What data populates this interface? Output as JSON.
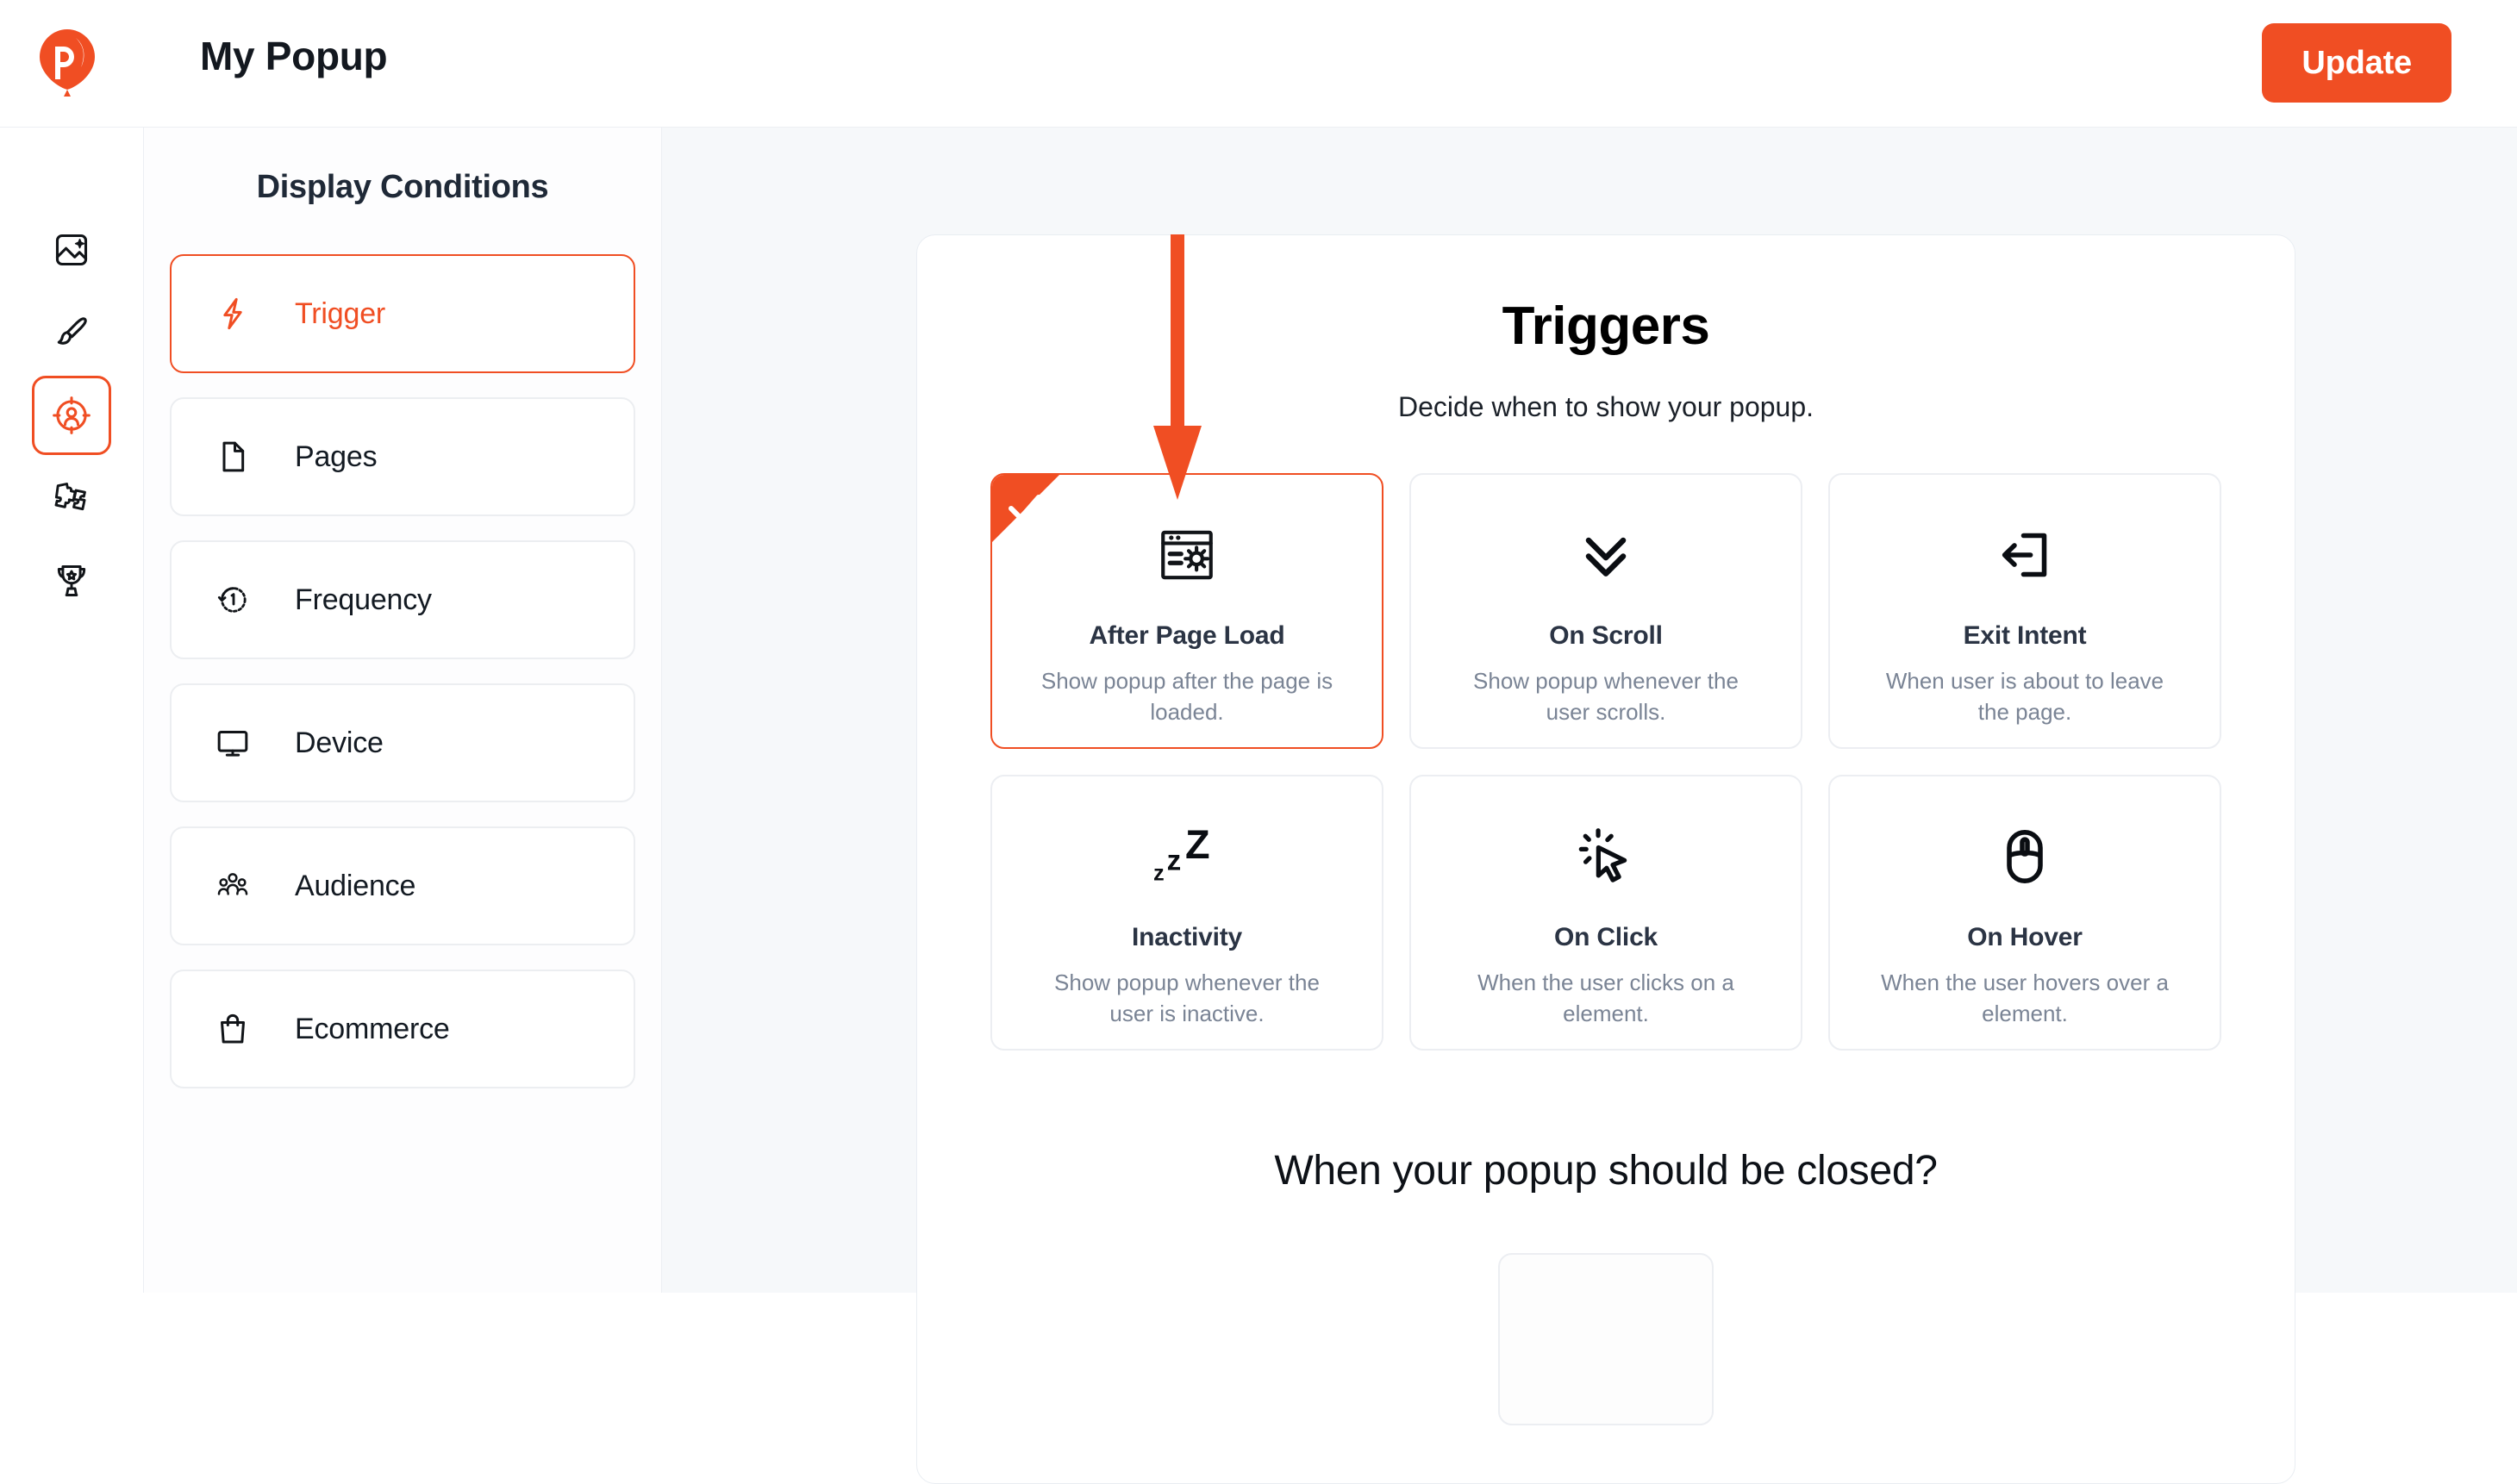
{
  "brand": {
    "accent": "#f04e23",
    "logo_icon": "balloon-p-logo",
    "text_dark": "#13181f"
  },
  "header": {
    "title": "My Popup",
    "update_label": "Update"
  },
  "rail": {
    "items": [
      {
        "icon": "image-icon",
        "name": "media",
        "active": false
      },
      {
        "icon": "paintbrush-icon",
        "name": "design",
        "active": false
      },
      {
        "icon": "target-audience-icon",
        "name": "display-conditions",
        "active": true
      },
      {
        "icon": "puzzle-icon",
        "name": "integrations",
        "active": false
      },
      {
        "icon": "trophy-icon",
        "name": "goals",
        "active": false
      }
    ]
  },
  "panel": {
    "title": "Display Conditions",
    "items": [
      {
        "label": "Trigger",
        "icon": "lightning-bolt-icon",
        "active": true
      },
      {
        "label": "Pages",
        "icon": "document-icon",
        "active": false
      },
      {
        "label": "Frequency",
        "icon": "clock-history-icon",
        "active": false
      },
      {
        "label": "Device",
        "icon": "monitor-icon",
        "active": false
      },
      {
        "label": "Audience",
        "icon": "people-group-icon",
        "active": false
      },
      {
        "label": "Ecommerce",
        "icon": "shopping-bag-icon",
        "active": false
      }
    ]
  },
  "main": {
    "title": "Triggers",
    "subtitle": "Decide when to show your popup.",
    "triggers": [
      {
        "title": "After Page Load",
        "desc": "Show popup after the page is loaded.",
        "icon": "browser-window-sun-icon",
        "selected": true
      },
      {
        "title": "On Scroll",
        "desc": "Show popup whenever the user scrolls.",
        "icon": "double-chevron-down-icon",
        "selected": false
      },
      {
        "title": "Exit Intent",
        "desc": "When user is about to leave the page.",
        "icon": "exit-door-arrow-icon",
        "selected": false
      },
      {
        "title": "Inactivity",
        "desc": "Show popup whenever the user is inactive.",
        "icon": "sleep-zzz-icon",
        "selected": false
      },
      {
        "title": "On Click",
        "desc": "When the user clicks on a element.",
        "icon": "cursor-click-icon",
        "selected": false
      },
      {
        "title": "On Hover",
        "desc": "When the user hovers over a element.",
        "icon": "mouse-icon",
        "selected": false
      }
    ],
    "section2_title": "When your popup should be closed?"
  },
  "annotation": {
    "arrow": "down-arrow-annotation",
    "color": "#f04e23"
  }
}
